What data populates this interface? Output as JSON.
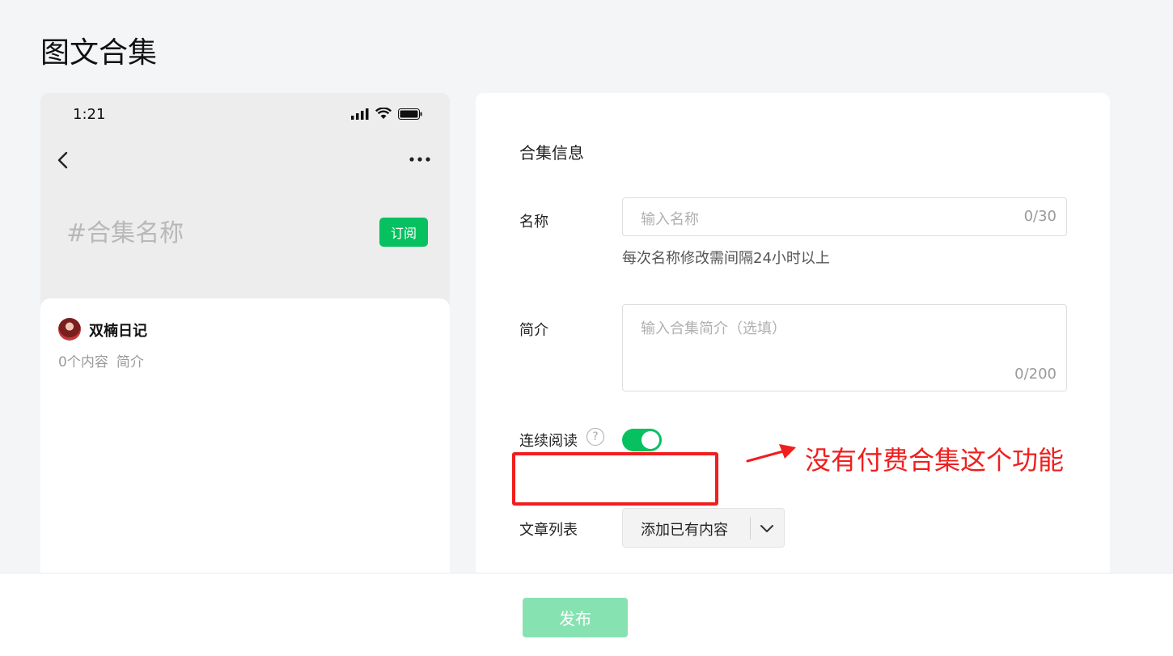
{
  "page": {
    "title": "图文合集"
  },
  "preview": {
    "status_time": "1:21",
    "collection_name": "#合集名称",
    "subscribe_label": "订阅",
    "author_name": "双楠日记",
    "content_count": "0个内容",
    "intro_label": "简介"
  },
  "form": {
    "section_title": "合集信息",
    "name": {
      "label": "名称",
      "placeholder": "输入名称",
      "counter": "0/30",
      "hint": "每次名称修改需间隔24小时以上"
    },
    "intro": {
      "label": "简介",
      "placeholder": "输入合集简介（选填）",
      "counter": "0/200"
    },
    "continuous_reading": {
      "label": "连续阅读",
      "help_symbol": "?",
      "enabled": true
    },
    "article_list": {
      "label": "文章列表",
      "button_label": "添加已有内容"
    }
  },
  "annotation": {
    "note": "没有付费合集这个功能",
    "color": "#f11e1e"
  },
  "footer": {
    "publish_label": "发布"
  },
  "colors": {
    "accent": "#07c160",
    "publish_disabled": "#87e2b2"
  }
}
